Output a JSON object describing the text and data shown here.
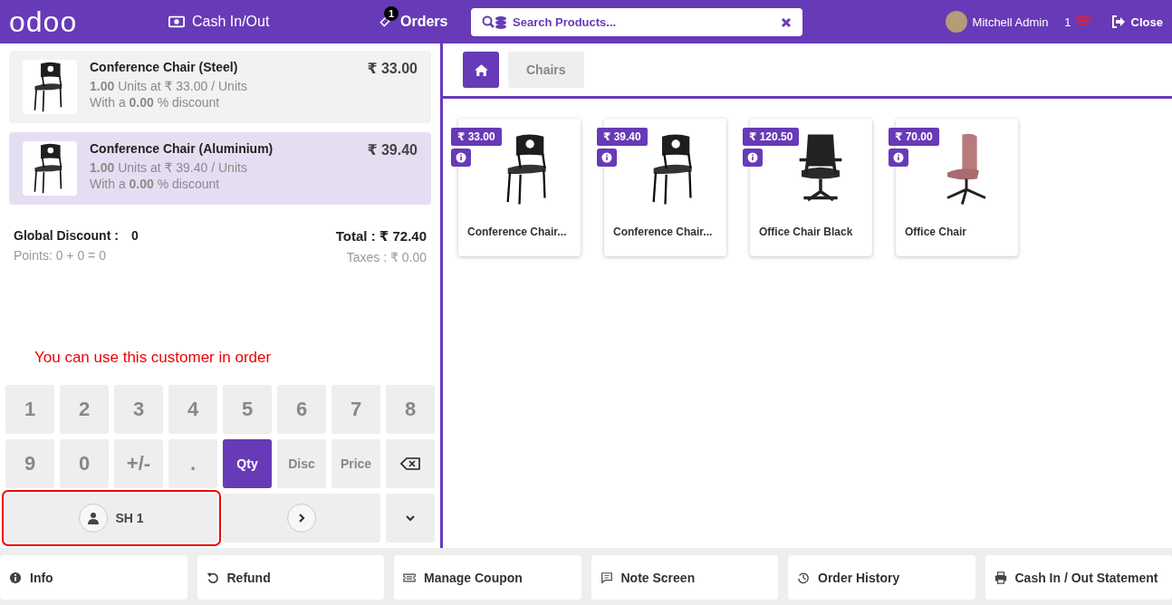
{
  "header": {
    "logo": "odoo",
    "cash": "Cash In/Out",
    "orders": {
      "badge": "1",
      "label": "Orders"
    },
    "search": {
      "placeholder": "Search Products..."
    },
    "user": "Mitchell Admin",
    "connection": "1",
    "close": "Close"
  },
  "order_lines": [
    {
      "name": "Conference Chair (Steel)",
      "detail": "**1.00** Units at ₹ 33.00 / Units",
      "discount": "With a **0.00** % discount",
      "price": "₹ 33.00",
      "selected": false
    },
    {
      "name": "Conference Chair (Aluminium)",
      "detail": "**1.00** Units at ₹ 39.40 / Units",
      "discount": "With a **0.00** % discount",
      "price": "₹ 39.40",
      "selected": true
    }
  ],
  "summary": {
    "global_discount_label": "Global Discount :",
    "global_discount_value": "0",
    "points": "Points: 0 + 0 = 0",
    "total": "Total : ₹ 72.40",
    "taxes": "Taxes : ₹ 0.00"
  },
  "notice": "You can use this customer in order",
  "numpad": [
    {
      "kind": "digit",
      "label": "1"
    },
    {
      "kind": "digit",
      "label": "2"
    },
    {
      "kind": "digit",
      "label": "3"
    },
    {
      "kind": "digit",
      "label": "4"
    },
    {
      "kind": "digit",
      "label": "5"
    },
    {
      "kind": "digit",
      "label": "6"
    },
    {
      "kind": "digit",
      "label": "7"
    },
    {
      "kind": "digit",
      "label": "8"
    },
    {
      "kind": "digit",
      "label": "9"
    },
    {
      "kind": "digit",
      "label": "0"
    },
    {
      "kind": "digit",
      "label": "+/-"
    },
    {
      "kind": "digit",
      "label": "."
    },
    {
      "kind": "mode",
      "label": "Qty",
      "selected": true
    },
    {
      "kind": "mode",
      "label": "Disc",
      "selected": false
    },
    {
      "kind": "mode",
      "label": "Price",
      "selected": false
    },
    {
      "kind": "backspace"
    }
  ],
  "customer": {
    "label": "SH 1",
    "highlighted": true
  },
  "categories": [
    {
      "label": "Chairs"
    }
  ],
  "products": [
    {
      "price": "₹ 33.00",
      "name": "Conference Chair...",
      "kind": "stacking"
    },
    {
      "price": "₹ 39.40",
      "name": "Conference Chair...",
      "kind": "stacking"
    },
    {
      "price": "₹ 120.50",
      "name": "Office Chair Black",
      "kind": "office"
    },
    {
      "price": "₹ 70.00",
      "name": "Office Chair",
      "kind": "swivel"
    }
  ],
  "footer": [
    {
      "kind": "info",
      "label": "Info"
    },
    {
      "kind": "refund",
      "label": "Refund"
    },
    {
      "kind": "coupon",
      "label": "Manage Coupon"
    },
    {
      "kind": "note",
      "label": "Note Screen"
    },
    {
      "kind": "history",
      "label": "Order History"
    },
    {
      "kind": "print",
      "label": "Cash In / Out Statement"
    }
  ]
}
